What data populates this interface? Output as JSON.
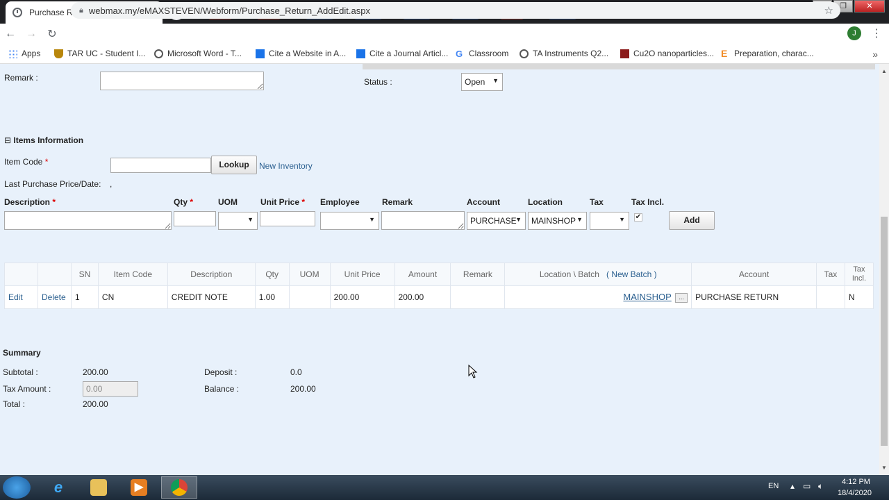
{
  "browser": {
    "tab_title": "Purchase Return",
    "tab_close": "✕",
    "new_tab": "+",
    "url": "webmax.my/eMAXSTEVEN/Webform/Purchase_Return_AddEdit.aspx",
    "avatar_letter": "J",
    "bookmarks": [
      {
        "label": "Apps"
      },
      {
        "label": "TAR UC - Student I..."
      },
      {
        "label": "Microsoft Word - T..."
      },
      {
        "label": "Cite a Website in A..."
      },
      {
        "label": "Cite a Journal Articl..."
      },
      {
        "label": "Classroom"
      },
      {
        "label": "TA Instruments Q2..."
      },
      {
        "label": "Cu2O nanoparticles..."
      },
      {
        "label": "Preparation, charac..."
      }
    ],
    "bookmarks_more": "»"
  },
  "header": {
    "remark_label": "Remark :",
    "status_label": "Status :",
    "status_value": "Open"
  },
  "items_info": {
    "section_title": "Items Information",
    "item_code_label": "Item Code",
    "lookup_button": "Lookup",
    "new_inventory_link": "New Inventory",
    "last_purchase_label": "Last Purchase Price/Date:",
    "last_purchase_value": ",",
    "columns": {
      "description": "Description",
      "qty": "Qty",
      "uom": "UOM",
      "unit_price": "Unit Price",
      "employee": "Employee",
      "remark": "Remark",
      "account": "Account",
      "location": "Location",
      "tax": "Tax",
      "tax_incl": "Tax Incl."
    },
    "account_value": "PURCHASE",
    "location_value": "MAINSHOP",
    "tax_incl_checked": true,
    "add_button": "Add"
  },
  "grid": {
    "headers": {
      "sn": "SN",
      "item_code": "Item Code",
      "description": "Description",
      "qty": "Qty",
      "uom": "UOM",
      "unit_price": "Unit Price",
      "amount": "Amount",
      "remark": "Remark",
      "location_batch": "Location \\ Batch",
      "new_batch": "( New Batch )",
      "account": "Account",
      "tax": "Tax",
      "tax_incl": "Tax Incl."
    },
    "rows": [
      {
        "edit": "Edit",
        "delete": "Delete",
        "sn": "1",
        "item_code": "CN",
        "description": "CREDIT NOTE",
        "qty": "1.00",
        "uom": "",
        "unit_price": "200.00",
        "amount": "200.00",
        "remark": "",
        "location": "MAINSHOP",
        "batch_button": "...",
        "account": "PURCHASE RETURN",
        "tax": "",
        "tax_incl": "N"
      }
    ]
  },
  "summary": {
    "title": "Summary",
    "subtotal_label": "Subtotal :",
    "subtotal_value": "200.00",
    "tax_amount_label": "Tax Amount :",
    "tax_amount_value": "0.00",
    "total_label": "Total :",
    "total_value": "200.00",
    "deposit_label": "Deposit :",
    "deposit_value": "0.0",
    "balance_label": "Balance :",
    "balance_value": "200.00"
  },
  "taskbar": {
    "lang": "EN",
    "time": "4:12 PM",
    "date": "18/4/2020"
  }
}
